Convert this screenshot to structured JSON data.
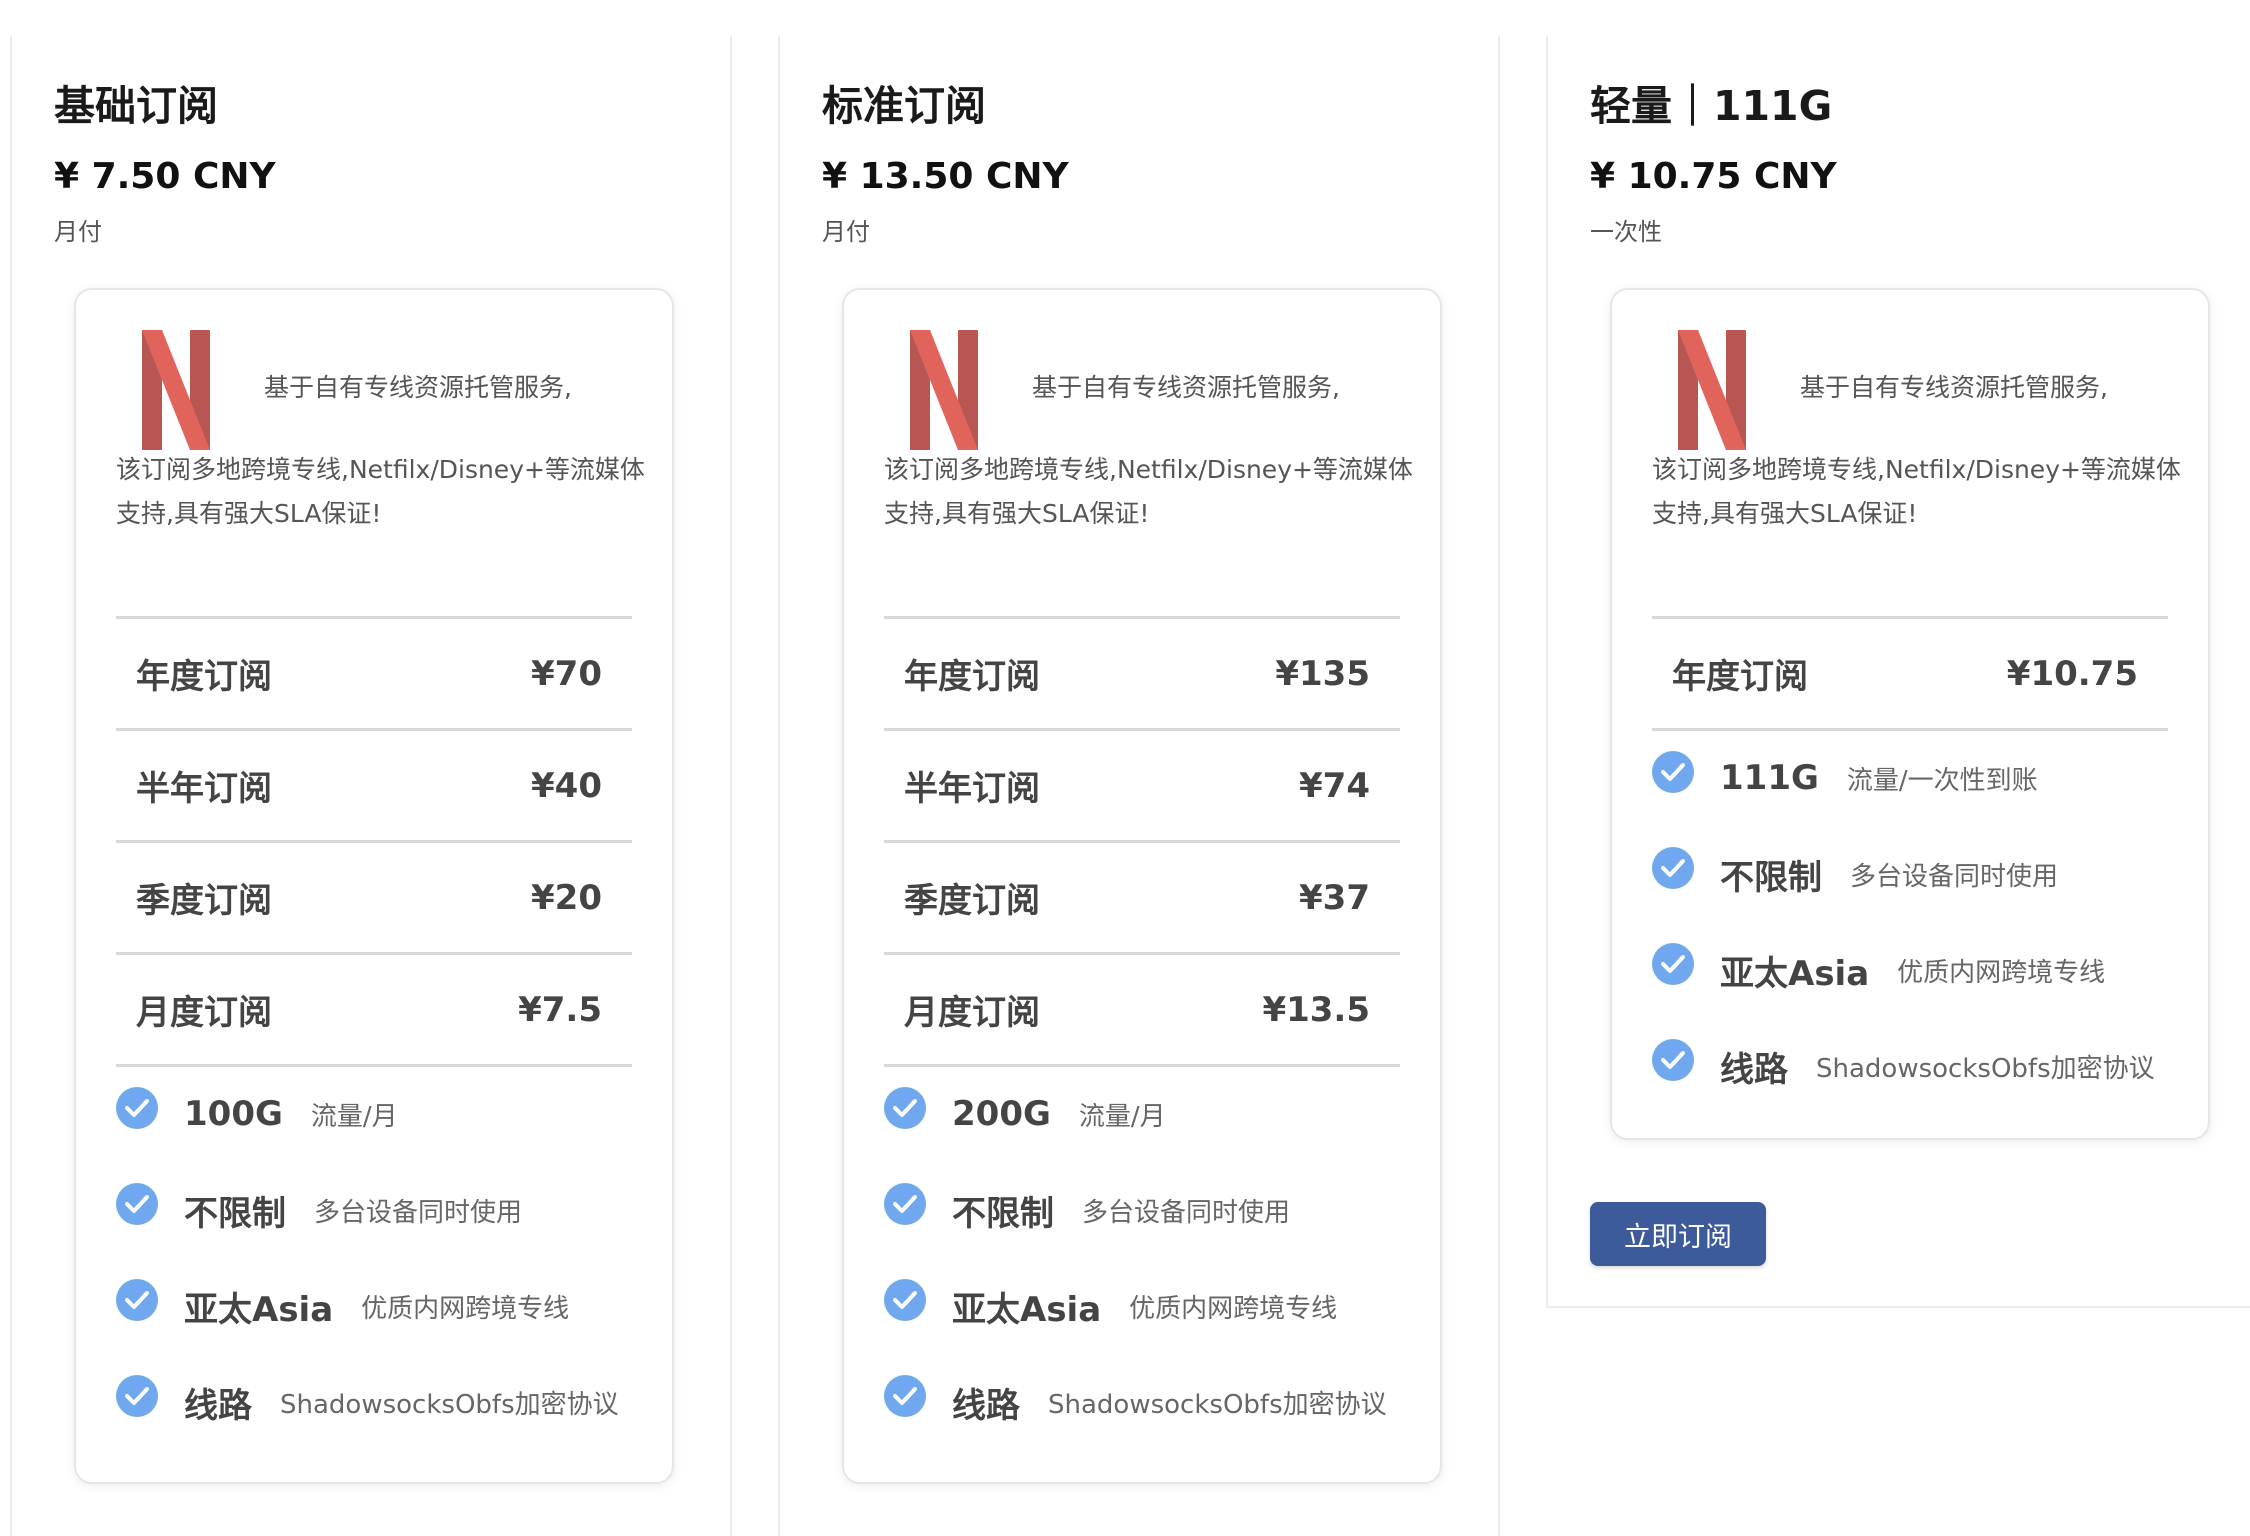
{
  "plans": [
    {
      "title": "基础订阅",
      "price": "¥ 7.50 CNY",
      "period": "月付",
      "desc_first": "基于自有专线资源托管服务,",
      "desc_rest": "该订阅多地跨境专线,Netfilx/Disney+等流媒体支持,具有强大SLA保证!",
      "rows": [
        {
          "label": "年度订阅",
          "value": "¥70"
        },
        {
          "label": "半年订阅",
          "value": "¥40"
        },
        {
          "label": "季度订阅",
          "value": "¥20"
        },
        {
          "label": "月度订阅",
          "value": "¥7.5"
        }
      ],
      "features": [
        {
          "title": "100G",
          "desc": "流量/月"
        },
        {
          "title": "不限制",
          "desc": "多台设备同时使用"
        },
        {
          "title": "亚太Asia",
          "desc": "优质内网跨境专线"
        },
        {
          "title": "线路",
          "desc": "ShadowsocksObfs加密协议"
        }
      ]
    },
    {
      "title": "标准订阅",
      "price": "¥ 13.50 CNY",
      "period": "月付",
      "desc_first": "基于自有专线资源托管服务,",
      "desc_rest": "该订阅多地跨境专线,Netfilx/Disney+等流媒体支持,具有强大SLA保证!",
      "rows": [
        {
          "label": "年度订阅",
          "value": "¥135"
        },
        {
          "label": "半年订阅",
          "value": "¥74"
        },
        {
          "label": "季度订阅",
          "value": "¥37"
        },
        {
          "label": "月度订阅",
          "value": "¥13.5"
        }
      ],
      "features": [
        {
          "title": "200G",
          "desc": "流量/月"
        },
        {
          "title": "不限制",
          "desc": "多台设备同时使用"
        },
        {
          "title": "亚太Asia",
          "desc": "优质内网跨境专线"
        },
        {
          "title": "线路",
          "desc": "ShadowsocksObfs加密协议"
        }
      ]
    },
    {
      "title": "轻量｜111G",
      "price": "¥ 10.75 CNY",
      "period": "一次性",
      "desc_first": "基于自有专线资源托管服务,",
      "desc_rest": "该订阅多地跨境专线,Netfilx/Disney+等流媒体支持,具有强大SLA保证!",
      "rows": [
        {
          "label": "年度订阅",
          "value": "¥10.75"
        }
      ],
      "features": [
        {
          "title": "111G",
          "desc": "流量/一次性到账"
        },
        {
          "title": "不限制",
          "desc": "多台设备同时使用"
        },
        {
          "title": "亚太Asia",
          "desc": "优质内网跨境专线"
        },
        {
          "title": "线路",
          "desc": "ShadowsocksObfs加密协议"
        }
      ],
      "button_label": "立即订阅"
    }
  ],
  "icons": {
    "logo": "netflix-logo",
    "check": "check-circle-icon"
  },
  "colors": {
    "netflix_red": "#e0645c",
    "netflix_dark": "#b85654",
    "check_blue": "#6fa8ee",
    "button_bg": "#3d5a9b"
  }
}
